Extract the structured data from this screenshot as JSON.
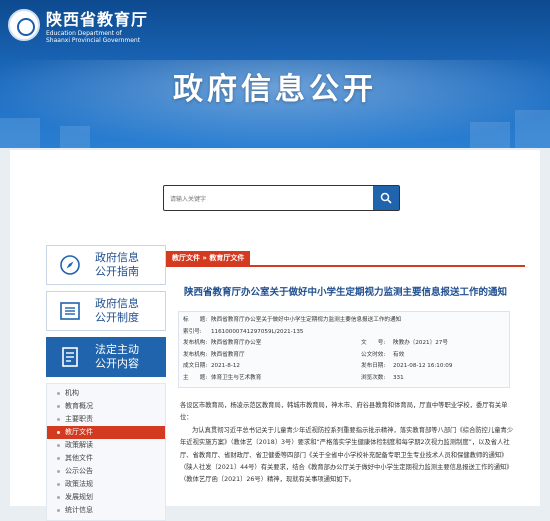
{
  "header": {
    "site_name": "陕西省教育厅",
    "site_name_en_1": "Education Department of",
    "site_name_en_2": "Shaanxi Provincial Government",
    "banner_title": "政府信息公开"
  },
  "search": {
    "placeholder": "请输入关键字"
  },
  "sidebar": {
    "buttons": [
      {
        "label_1": "政府信息",
        "label_2": "公开指南"
      },
      {
        "label_1": "政府信息",
        "label_2": "公开制度"
      },
      {
        "label_1": "法定主动",
        "label_2": "公开内容"
      }
    ],
    "items": [
      "机构",
      "教育概况",
      "主要职责",
      "教厅文件",
      "政策解读",
      "其他文件",
      "公示公告",
      "政策法规",
      "发展规划",
      "统计信息"
    ]
  },
  "breadcrumb": "教厅文件 » 教育厅文件",
  "article": {
    "title": "陕西省教育厅办公室关于做好中小学生定期视力监测主要信息报送工作的通知",
    "meta": [
      {
        "k1": "标　　题:",
        "v1": "陕西省教育厅办公室关于做好中小学生定期视力监测主要信息报送工作的通知",
        "k2": "",
        "v2": ""
      },
      {
        "k1": "索引号:",
        "v1": "11610000741297059L/2021-135",
        "k2": "",
        "v2": ""
      },
      {
        "k1": "发布机构:",
        "v1": "陕西省教育厅办公室",
        "k2": "文　　号:",
        "v2": "陕教办〔2021〕27号"
      },
      {
        "k1": "发布机构:",
        "v1": "陕西省教育厅",
        "k2": "公文时效:",
        "v2": "有效"
      },
      {
        "k1": "成文日期:",
        "v1": "2021-8-12",
        "k2": "发布日期:",
        "v2": "2021-08-12 16:10:09"
      },
      {
        "k1": "主　　题:",
        "v1": "体育卫生与艺术教育",
        "k2": "浏览次数:",
        "v2": "331"
      }
    ],
    "recipients": "各设区市教育局，杨凌示范区教育局，韩城市教育局，神木市、府谷县教育和体育局，厅直中等职业学校，委厅有关单位：",
    "body": "为认真贯彻习近平总书记关于儿童青少年近视防控系列重要指示批示精神，落实教育部等八部门《综合防控儿童青少年近视实施方案》（教体艺〔2018〕3号）要求和“严格落实学生健康体检制度和每学期2次视力监测制度”，以及省人社厅、省教育厅、省财政厅、省卫健委等四部门《关于全省中小学校补充配备专职卫生专业技术人员和保健教师的通知》（陕人社发〔2021〕44号）有关要求，结合《教育部办公厅关于做好中小学生定期视力监测主要信息报送工作的通知》（教体艺厅函〔2021〕26号）精神，现就有关事项通知如下。"
  }
}
